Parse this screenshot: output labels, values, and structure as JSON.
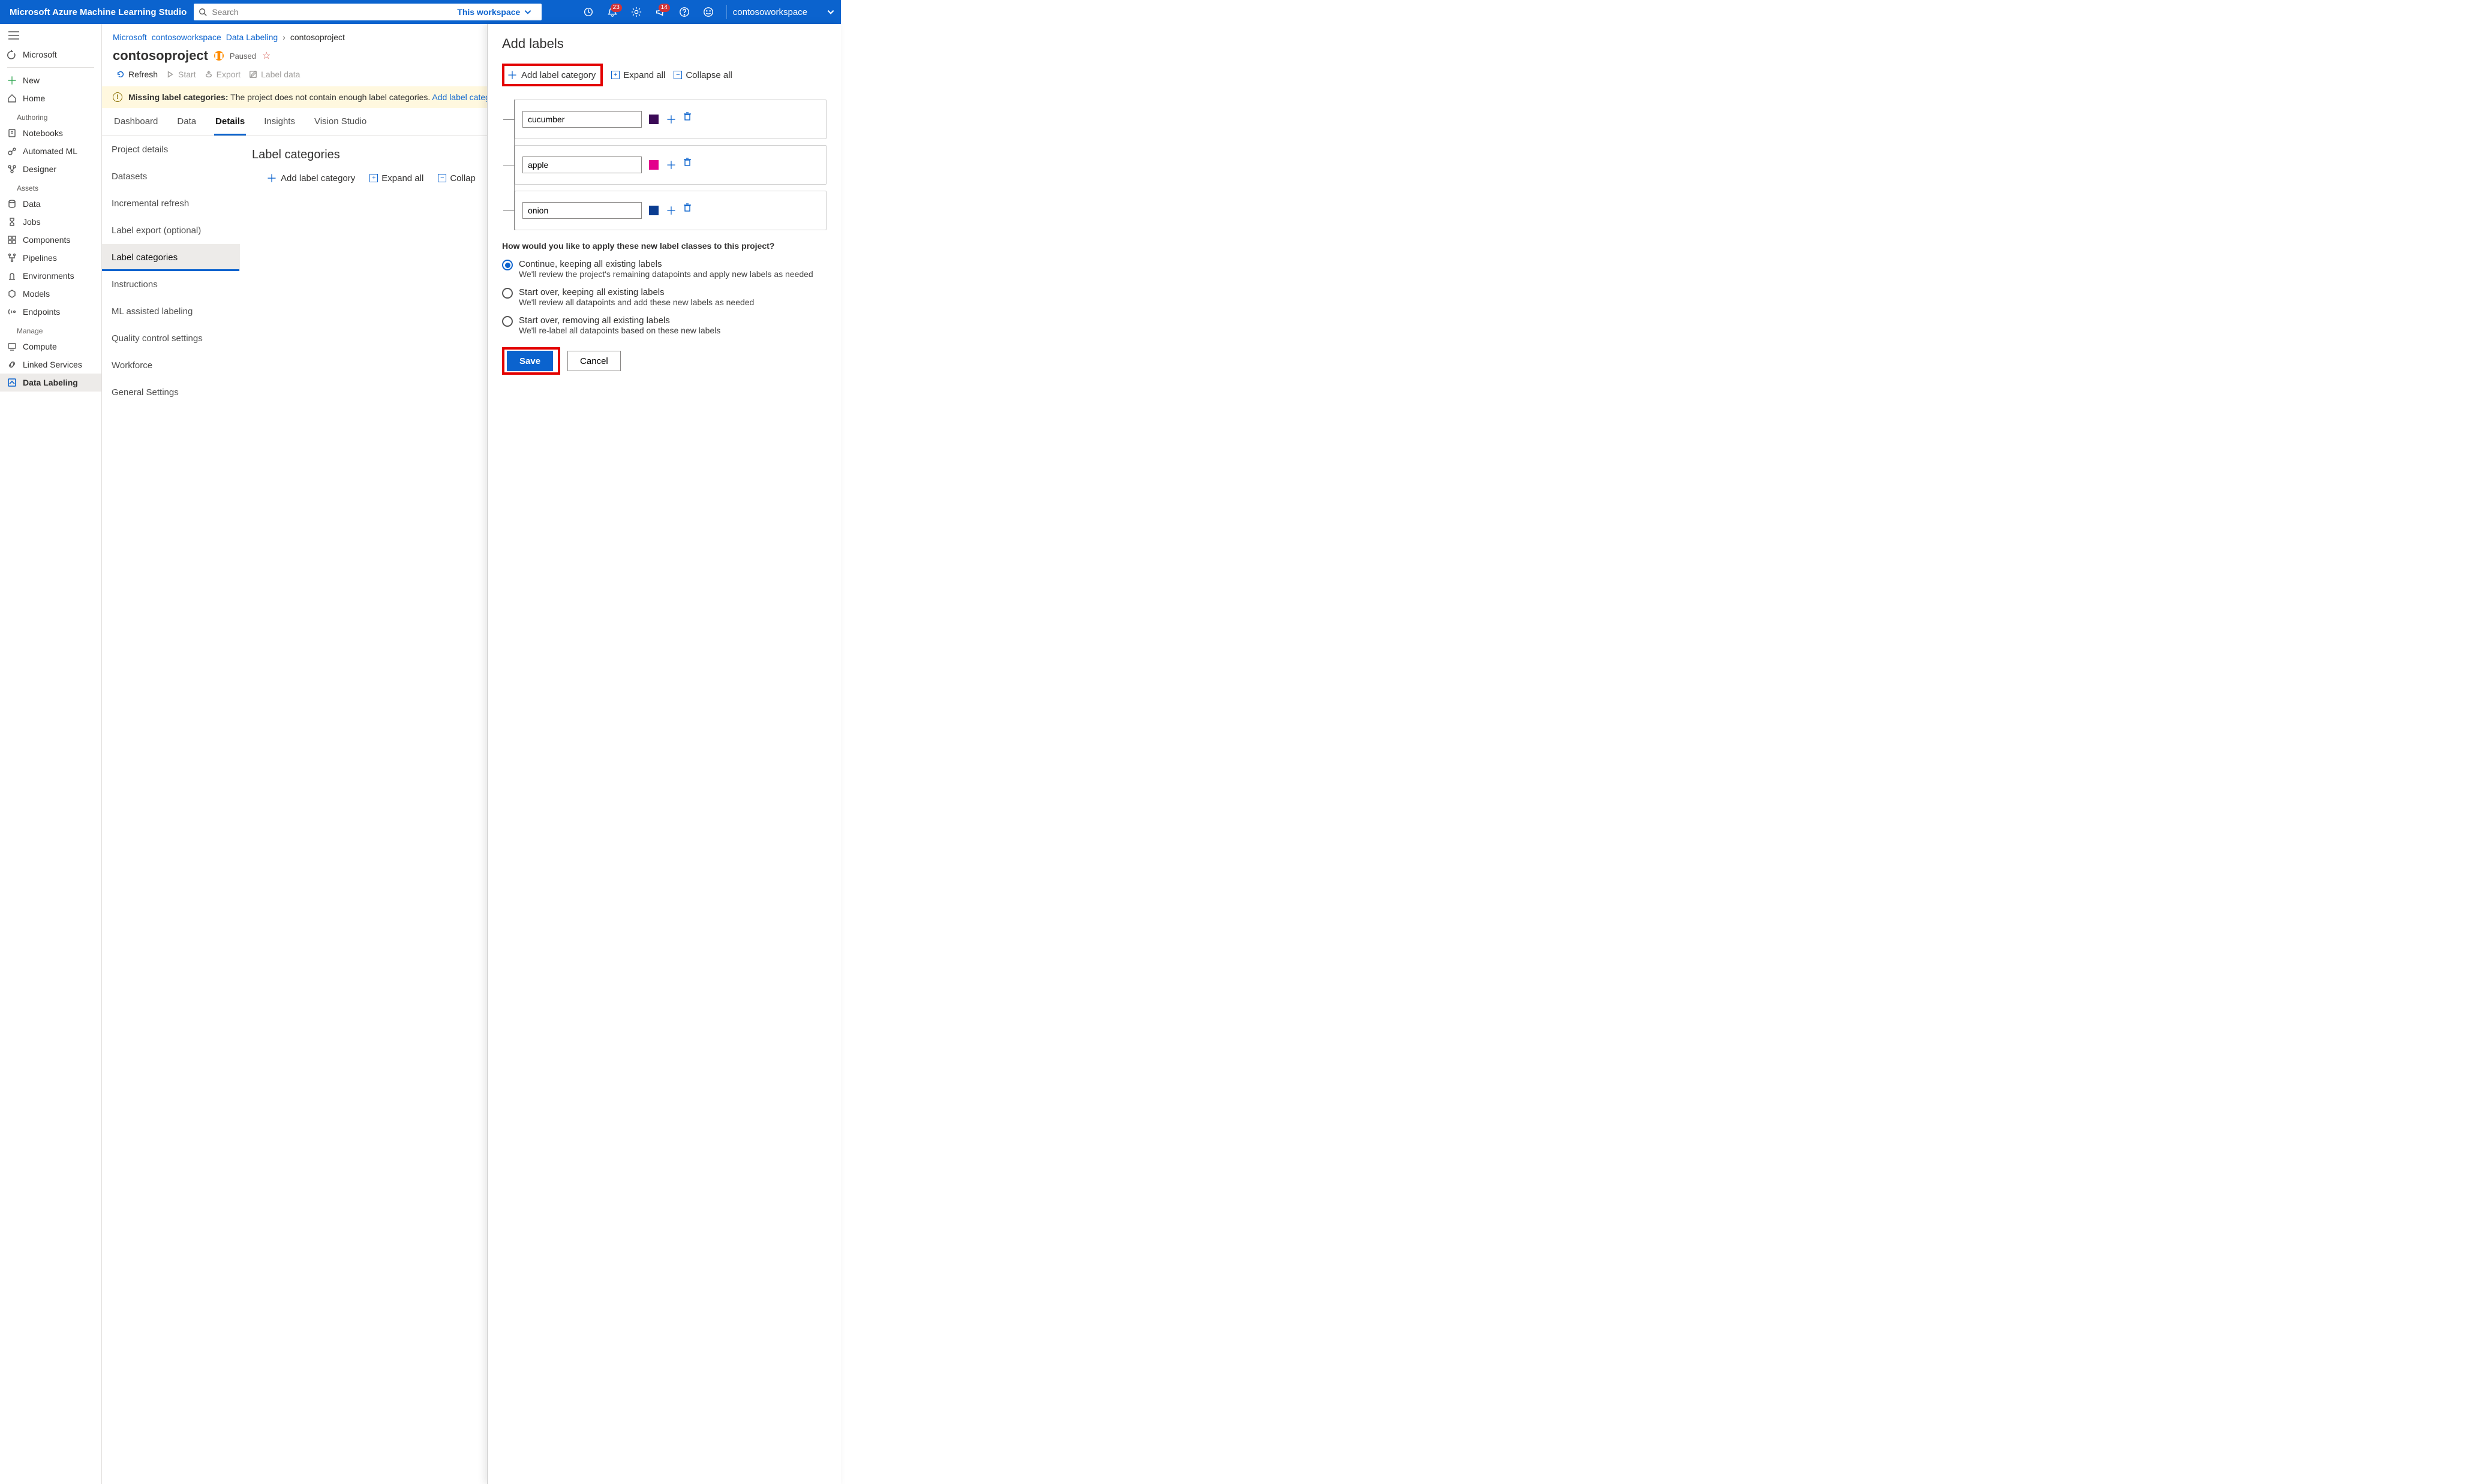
{
  "header": {
    "brand": "Microsoft Azure Machine Learning Studio",
    "search_placeholder": "Search",
    "scope_label": "This workspace",
    "badge_notifications": "23",
    "badge_feedback": "14",
    "workspace_name": "contosoworkspace"
  },
  "sidebar": {
    "back": "Microsoft",
    "new": "New",
    "home": "Home",
    "section_authoring": "Authoring",
    "notebooks": "Notebooks",
    "automl": "Automated ML",
    "designer": "Designer",
    "section_assets": "Assets",
    "data": "Data",
    "jobs": "Jobs",
    "components": "Components",
    "pipelines": "Pipelines",
    "environments": "Environments",
    "models": "Models",
    "endpoints": "Endpoints",
    "section_manage": "Manage",
    "compute": "Compute",
    "linked": "Linked Services",
    "labeling": "Data Labeling"
  },
  "breadcrumbs": {
    "b0": "Microsoft",
    "b1": "contosoworkspace",
    "b2": "Data Labeling",
    "b3": "contosoproject"
  },
  "project": {
    "title": "contosoproject",
    "status": "Paused",
    "cmd_refresh": "Refresh",
    "cmd_start": "Start",
    "cmd_export": "Export",
    "cmd_label": "Label data"
  },
  "banner": {
    "strong": "Missing label categories:",
    "text": "The project does not contain enough label categories.",
    "link": "Add label categories."
  },
  "tabs": {
    "t0": "Dashboard",
    "t1": "Data",
    "t2": "Details",
    "t3": "Insights",
    "t4": "Vision Studio"
  },
  "subnav": {
    "s0": "Project details",
    "s1": "Datasets",
    "s2": "Incremental refresh",
    "s3": "Label export (optional)",
    "s4": "Label categories",
    "s5": "Instructions",
    "s6": "ML assisted labeling",
    "s7": "Quality control settings",
    "s8": "Workforce",
    "s9": "General Settings"
  },
  "details_main": {
    "heading": "Label categories",
    "add": "Add label category",
    "expand": "Expand all",
    "collapse": "Collap"
  },
  "flyout": {
    "title": "Add labels",
    "add": "Add label category",
    "expand": "Expand all",
    "collapse": "Collapse all",
    "labels": [
      {
        "name": "cucumber",
        "color": "#3b0a57"
      },
      {
        "name": "apple",
        "color": "#e3008c"
      },
      {
        "name": "onion",
        "color": "#0b3d91"
      }
    ],
    "apply_head": "How would you like to apply these new label classes to this project?",
    "options": [
      {
        "title": "Continue, keeping all existing labels",
        "sub": "We'll review the project's remaining datapoints and apply new labels as needed",
        "selected": true
      },
      {
        "title": "Start over, keeping all existing labels",
        "sub": "We'll review all datapoints and add these new labels as needed",
        "selected": false
      },
      {
        "title": "Start over, removing all existing labels",
        "sub": "We'll re-label all datapoints based on these new labels",
        "selected": false
      }
    ],
    "save": "Save",
    "cancel": "Cancel"
  }
}
